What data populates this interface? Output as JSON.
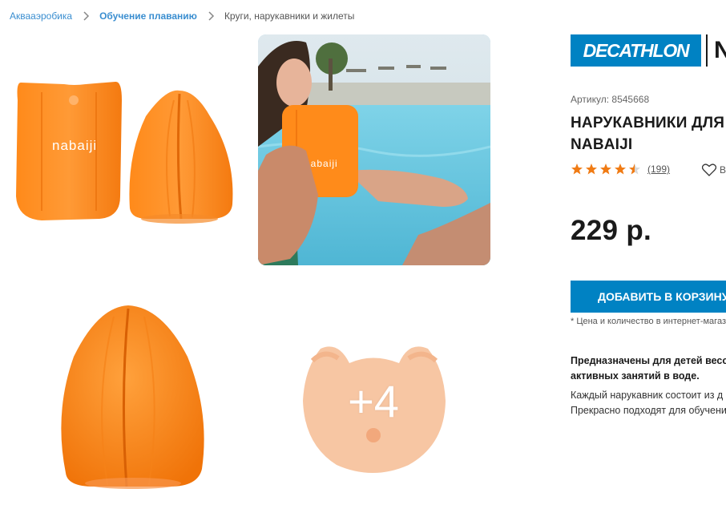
{
  "breadcrumb": {
    "items": [
      {
        "label": "Аквааэробика"
      },
      {
        "label": "Обучение плаванию"
      },
      {
        "label": "Круги, нарукавники и жилеты"
      }
    ]
  },
  "gallery": {
    "tile1": {
      "brand_print": "nabaiji"
    },
    "tile4": {
      "more_label": "+4"
    }
  },
  "brand": {
    "logo": "DECATHLON",
    "next_logo": "N"
  },
  "product": {
    "sku": "Артикул: 8545668",
    "title_line1": "НАРУКАВНИКИ ДЛЯ Н",
    "title_line2": "NABAIJI",
    "rating": 4.5,
    "reviews": "(199)",
    "wishlist_label": "В",
    "price": "229 р.",
    "cta": "ДОБАВИТЬ В КОРЗИНУ",
    "note": "* Цена и количество в интернет-магази",
    "desc_bold_1": "Предназначены для детей весом",
    "desc_bold_2": "активных занятий в воде.",
    "desc_1": "Каждый нарукавник состоит из д",
    "desc_2": "Прекрасно подходят для обучени"
  },
  "colors": {
    "accent": "#0082c3",
    "star": "#f07b14",
    "link": "#3a8ed0",
    "product_orange": "#ff8a1f"
  },
  "icons": {
    "breadcrumb_separator": "chevron-right-icon",
    "star": "star-icon",
    "wishlist": "heart-icon"
  }
}
